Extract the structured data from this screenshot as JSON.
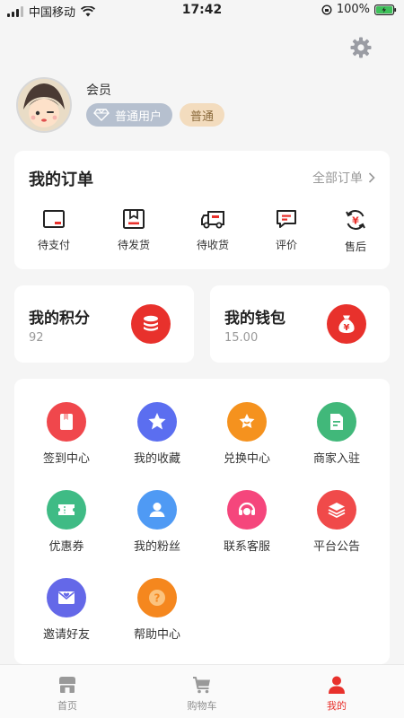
{
  "status_bar": {
    "carrier": "中国移动",
    "time": "17:42",
    "battery": "100%"
  },
  "profile": {
    "member_label": "会员",
    "user_badge": "普通用户",
    "level_badge": "普通"
  },
  "orders": {
    "title": "我的订单",
    "view_all": "全部订单",
    "items": [
      {
        "label": "待支付",
        "icon": "wallet-icon"
      },
      {
        "label": "待发货",
        "icon": "box-icon"
      },
      {
        "label": "待收货",
        "icon": "truck-icon"
      },
      {
        "label": "评价",
        "icon": "comment-icon"
      },
      {
        "label": "售后",
        "icon": "refund-icon"
      }
    ]
  },
  "points": {
    "title": "我的积分",
    "value": "92",
    "icon": "coins-icon"
  },
  "wallet": {
    "title": "我的钱包",
    "value": "15.00",
    "icon": "money-bag-icon"
  },
  "services": {
    "items": [
      {
        "label": "签到中心",
        "icon": "checkin-icon",
        "color": "#f0474c"
      },
      {
        "label": "我的收藏",
        "icon": "star-icon",
        "color": "#5b6ef0"
      },
      {
        "label": "兑换中心",
        "icon": "exchange-icon",
        "color": "#f5921e"
      },
      {
        "label": "商家入驻",
        "icon": "merchant-icon",
        "color": "#41b87a"
      },
      {
        "label": "优惠券",
        "icon": "coupon-icon",
        "color": "#3fbb85"
      },
      {
        "label": "我的粉丝",
        "icon": "fans-icon",
        "color": "#4f9af4"
      },
      {
        "label": "联系客服",
        "icon": "service-icon",
        "color": "#f5467c"
      },
      {
        "label": "平台公告",
        "icon": "notice-icon",
        "color": "#f04a4a"
      },
      {
        "label": "邀请好友",
        "icon": "invite-icon",
        "color": "#6468e8"
      },
      {
        "label": "帮助中心",
        "icon": "help-icon",
        "color": "#f5871e"
      }
    ]
  },
  "tab_bar": {
    "items": [
      {
        "label": "首页",
        "icon": "home-icon"
      },
      {
        "label": "购物车",
        "icon": "cart-icon"
      },
      {
        "label": "我的",
        "icon": "profile-icon"
      }
    ]
  },
  "colors": {
    "accent": "#e8312c",
    "background": "#f5f5f5"
  }
}
